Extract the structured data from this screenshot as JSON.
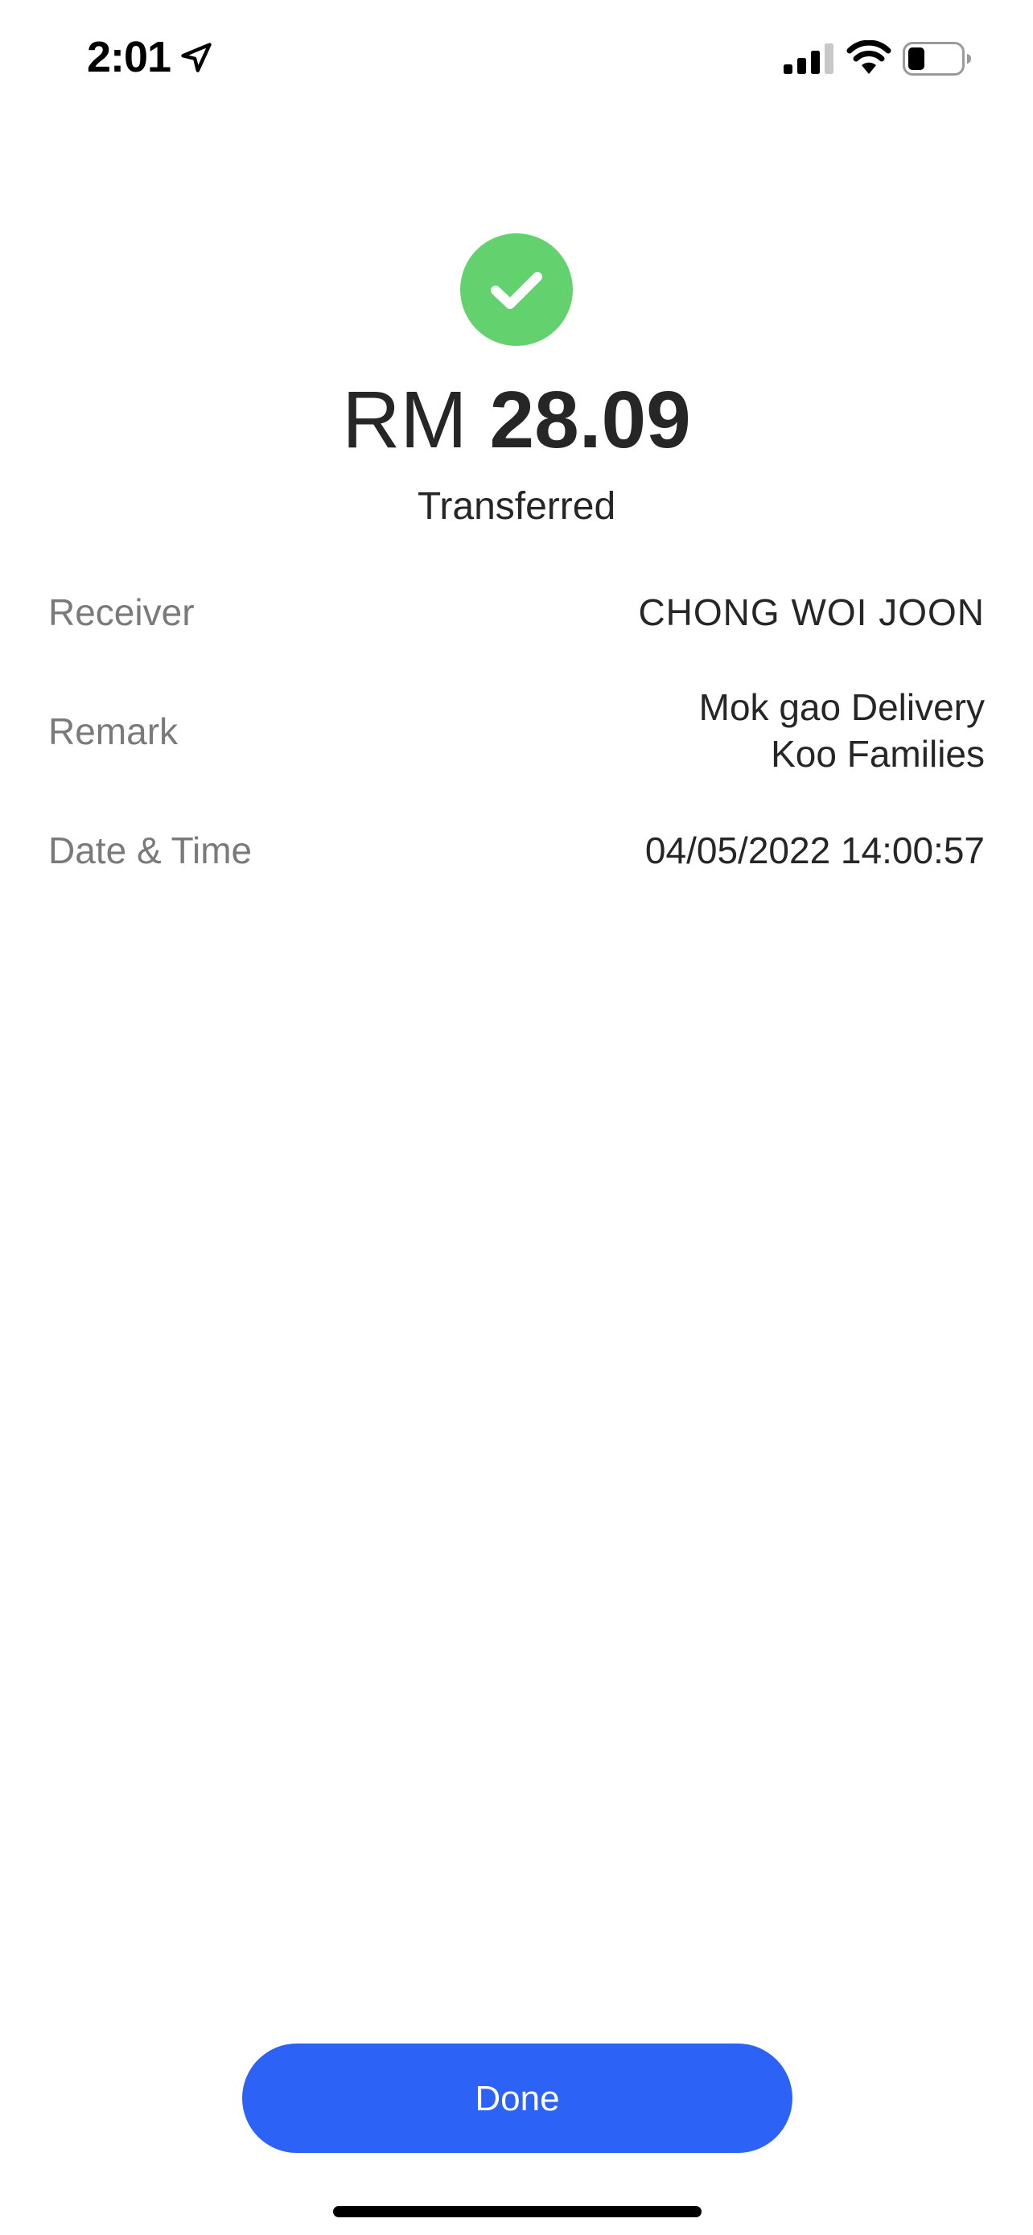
{
  "status_bar": {
    "time": "2:01",
    "icons": [
      "location-arrow-icon",
      "cellular-signal-icon",
      "wifi-icon",
      "battery-icon"
    ]
  },
  "colors": {
    "success": "#63d26e",
    "primary": "#2c62f6",
    "label": "#7a7a7a",
    "text": "#262626"
  },
  "transfer": {
    "currency": "RM",
    "amount": "28.09",
    "status": "Transferred"
  },
  "details": {
    "receiver": {
      "label": "Receiver",
      "value": "CHONG WOI JOON"
    },
    "remark": {
      "label": "Remark",
      "line1": "Mok gao Delivery",
      "line2": "Koo Families"
    },
    "datetime": {
      "label": "Date & Time",
      "value": "04/05/2022 14:00:57"
    }
  },
  "actions": {
    "done_label": "Done"
  }
}
